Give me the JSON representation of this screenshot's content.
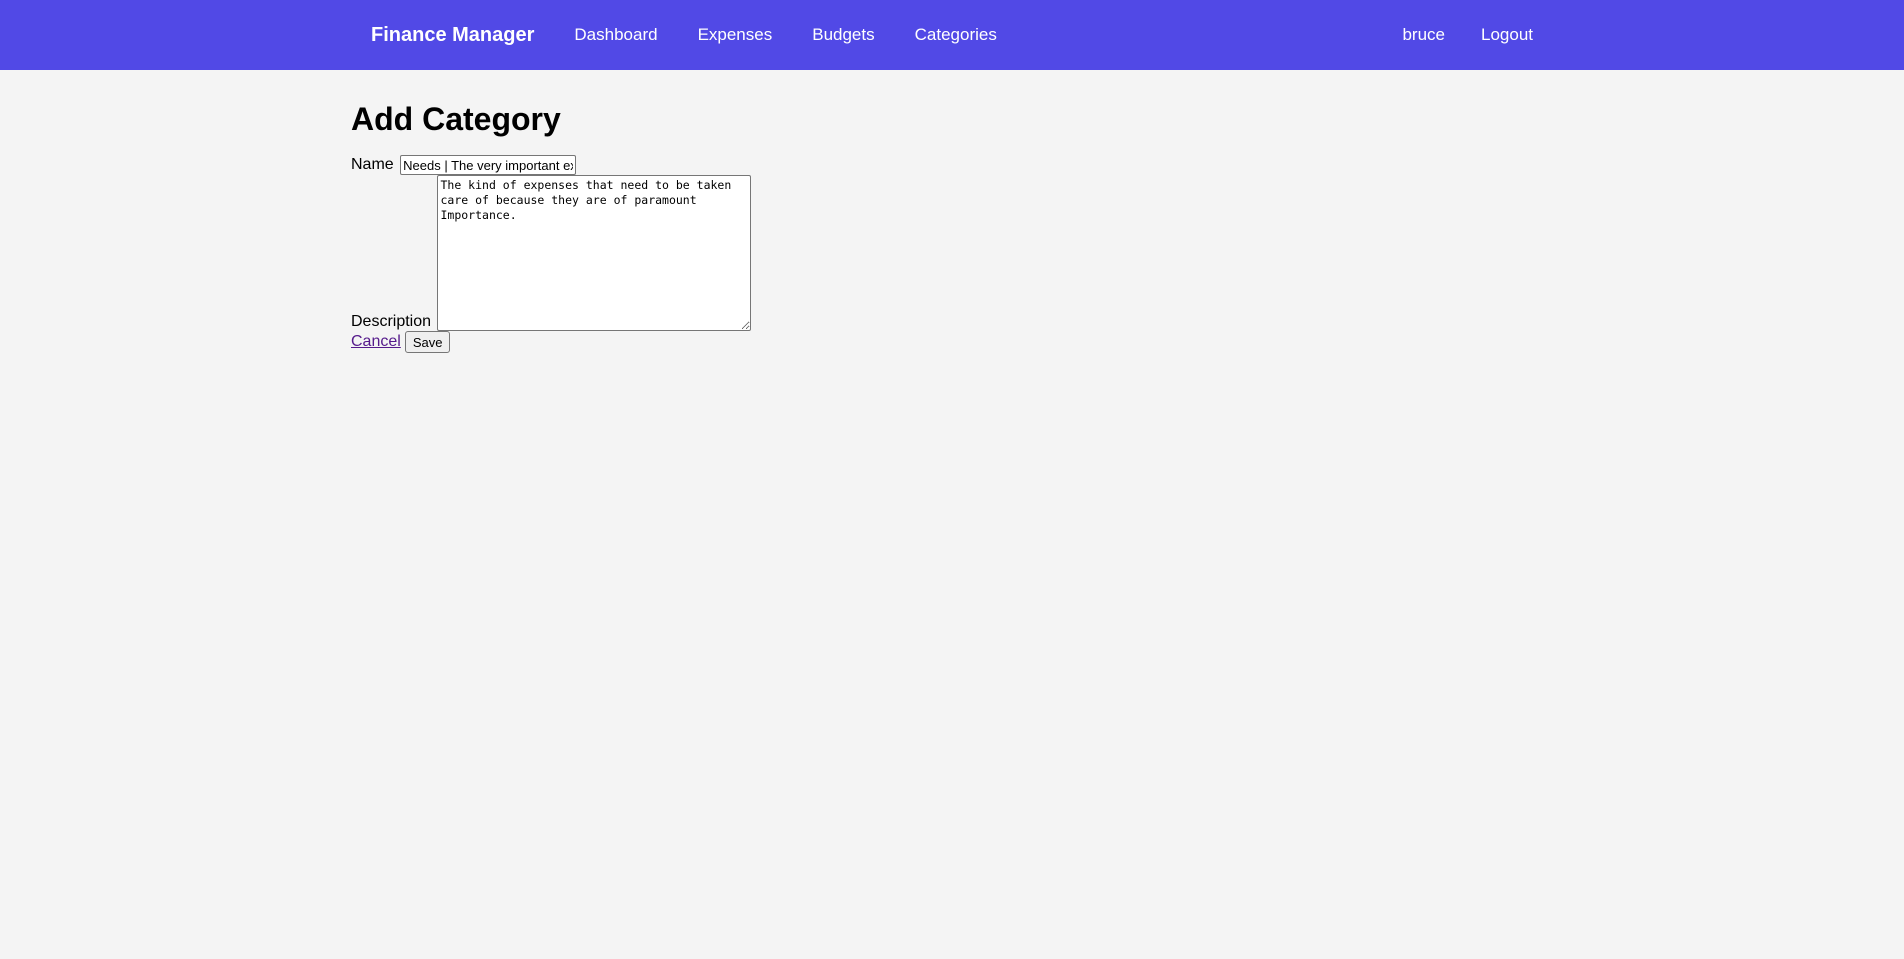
{
  "nav": {
    "brand": "Finance Manager",
    "links": [
      "Dashboard",
      "Expenses",
      "Budgets",
      "Categories"
    ],
    "user": "bruce",
    "logout": "Logout"
  },
  "page": {
    "title": "Add Category"
  },
  "form": {
    "name_label": "Name",
    "name_value": "Needs | The very important expenses",
    "description_label": "Description",
    "description_value": "The kind of expenses that need to be taken care of because they are of paramount Importance.",
    "cancel_label": "Cancel",
    "save_label": "Save"
  },
  "colors": {
    "navbar": "#5149e6",
    "background": "#f4f4f4",
    "link_visited": "#551a8b"
  }
}
